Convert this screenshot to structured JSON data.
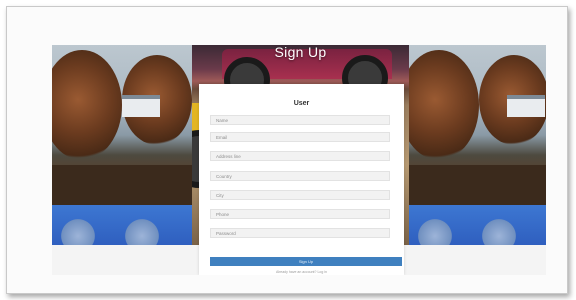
{
  "hero": {
    "title": "Sign Up"
  },
  "form": {
    "title": "User",
    "fields": [
      {
        "placeholder": "Name"
      },
      {
        "placeholder": "Email"
      },
      {
        "placeholder": "Address line"
      },
      {
        "placeholder": "Country"
      },
      {
        "placeholder": "City"
      },
      {
        "placeholder": "Phone"
      },
      {
        "placeholder": "Password"
      }
    ],
    "submit_label": "Sign Up",
    "footer_text": "Already have an account? Log in"
  },
  "colors": {
    "accent": "#3f80bf",
    "card": "#ffffff",
    "field_bg": "#f2f2f2"
  }
}
